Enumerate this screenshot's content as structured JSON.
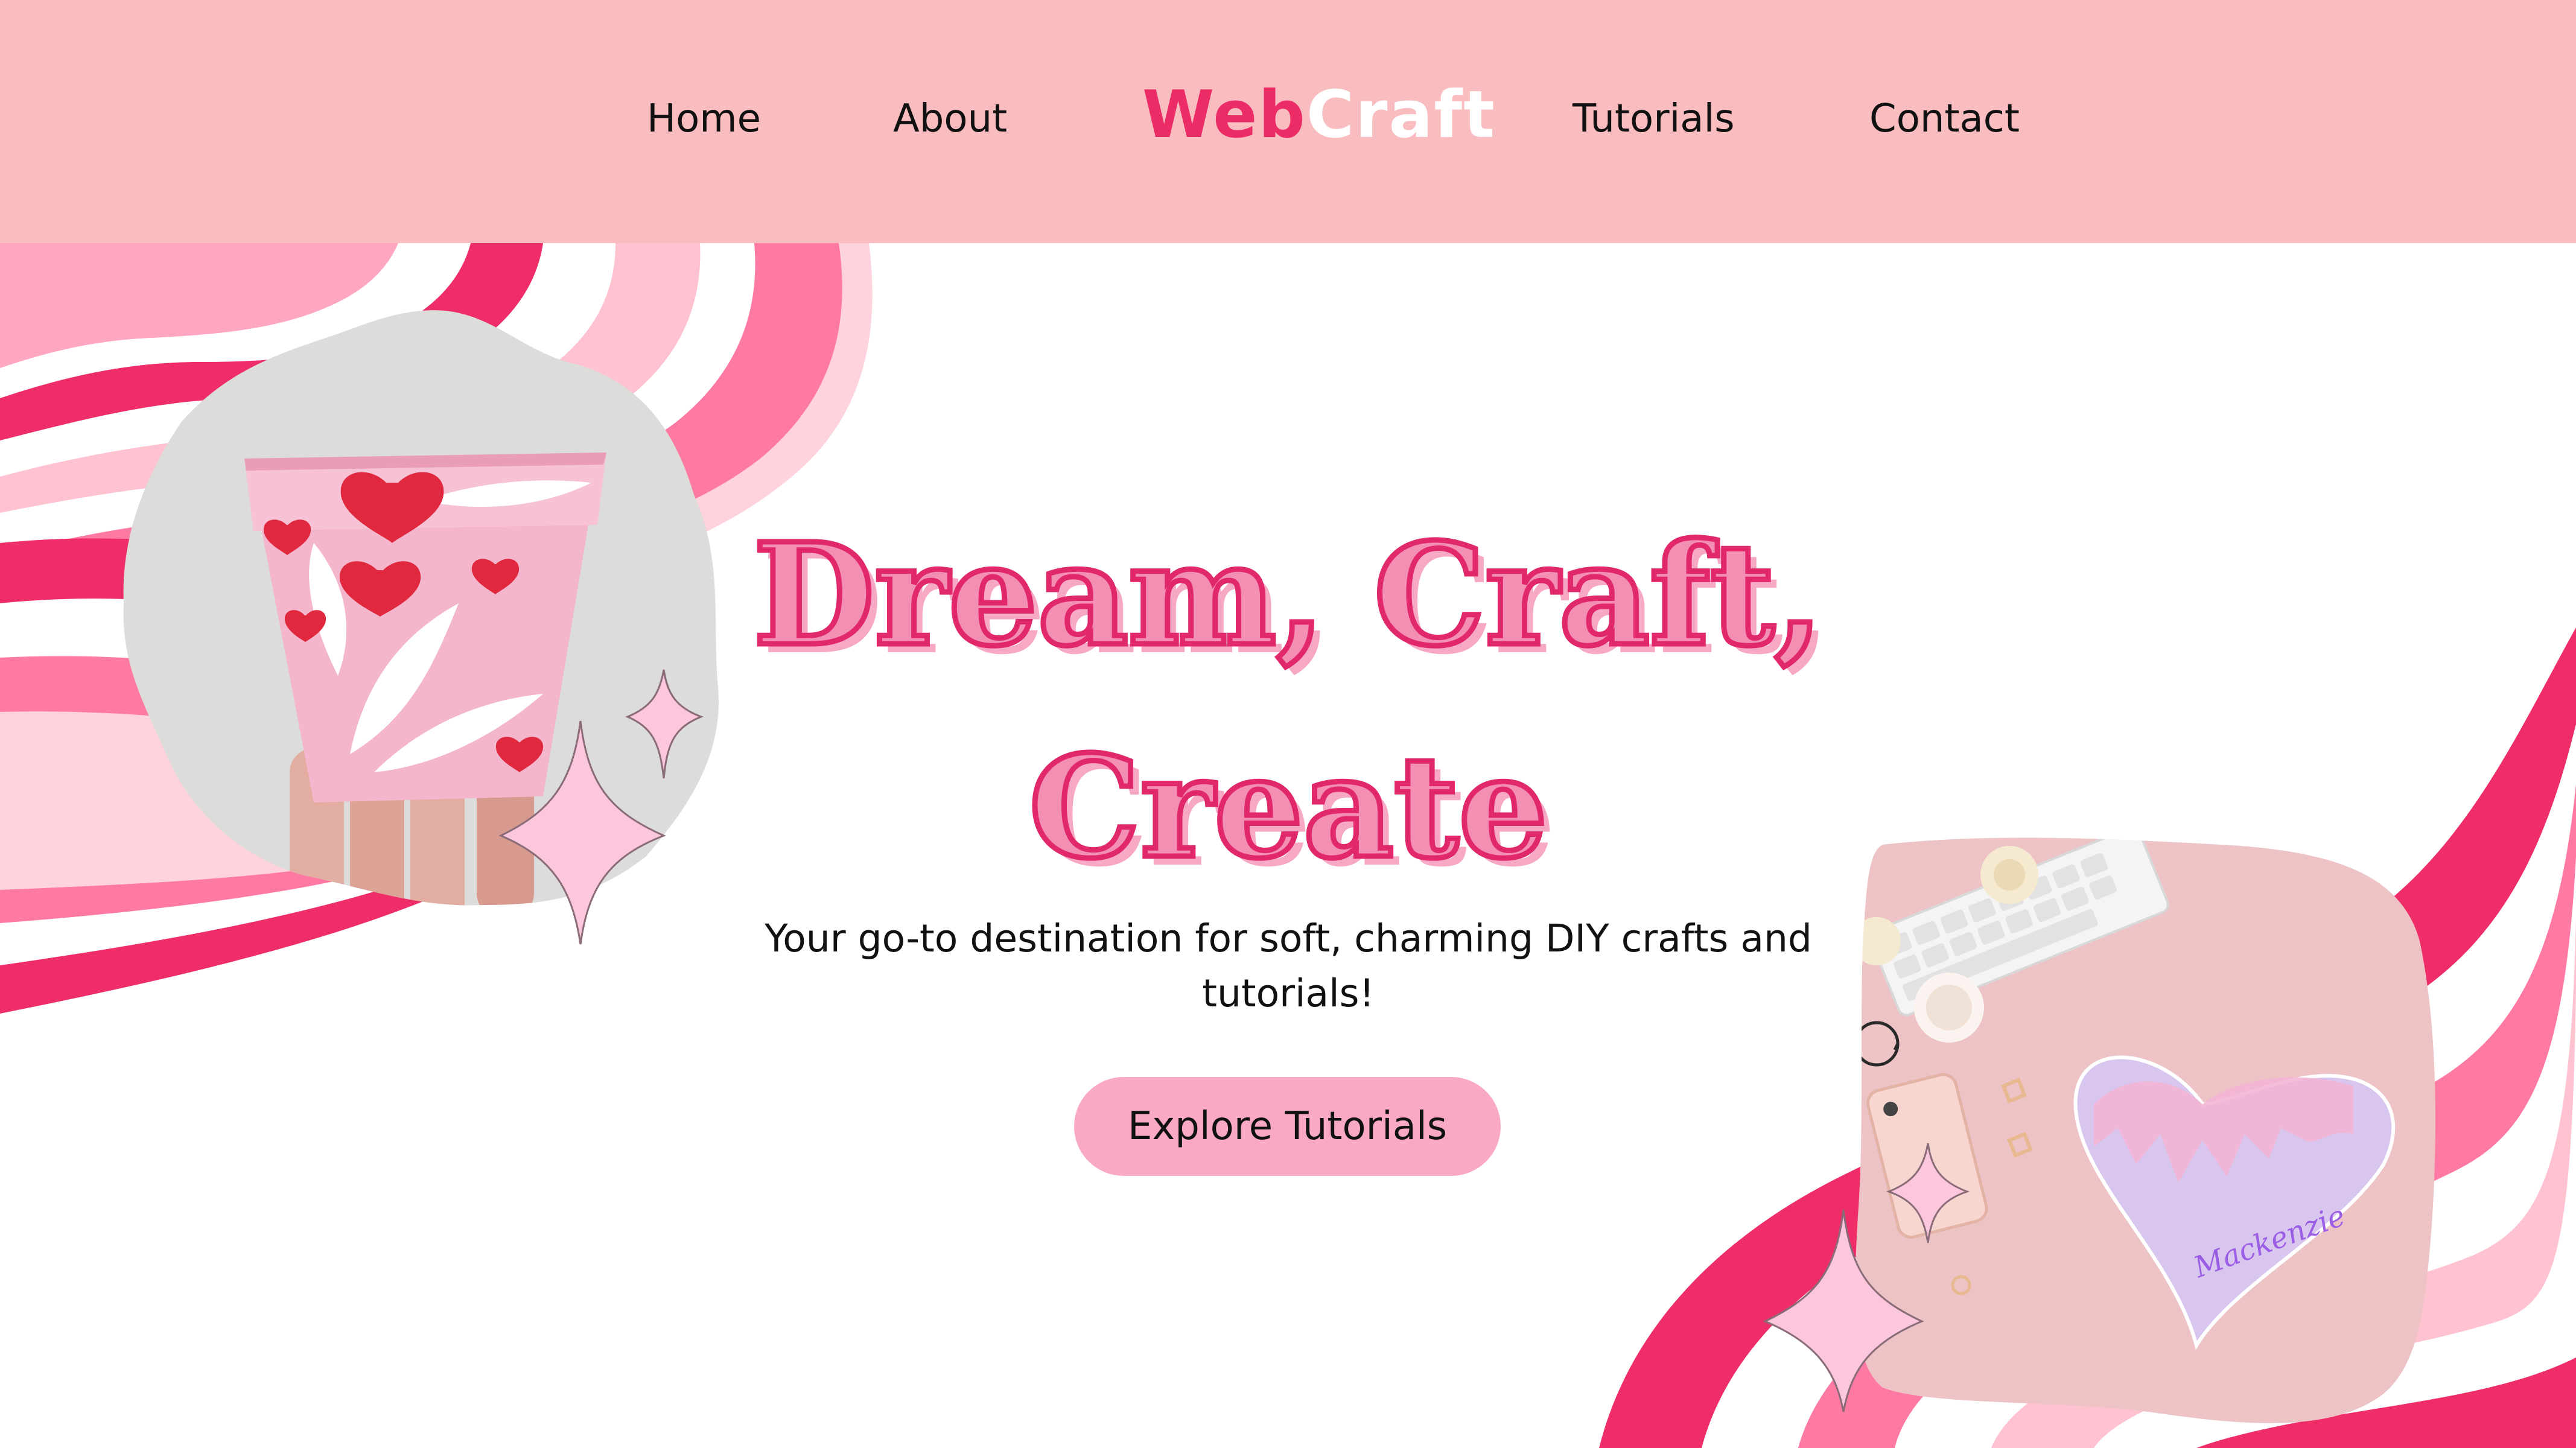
{
  "nav": {
    "left_links": [
      "Home",
      "About"
    ],
    "right_links": [
      "Tutorials",
      "Contact"
    ],
    "logo": {
      "part1": "Web",
      "part2": "Craft"
    }
  },
  "hero": {
    "title_line1": "Dream, Craft,",
    "title_line2": "Create",
    "tagline": "Your go-to destination for soft, charming DIY crafts and tutorials!",
    "cta_label": "Explore Tutorials"
  },
  "images": {
    "left_photo": "painted-heart-flower-pot-photo",
    "right_photo": "pink-desk-flatlay-photo",
    "notebook_lettering": "Mackenzie"
  },
  "colors": {
    "header_bg": "#f9bdc0",
    "logo_pink": "#ec2c67",
    "title_fill": "#f48fb4",
    "title_outline": "#e0286a",
    "button_bg": "#f9a9c6",
    "wave_hot_pink": "#ef2d68",
    "wave_pink": "#ff7aa2",
    "wave_light": "#ffd3dd"
  }
}
